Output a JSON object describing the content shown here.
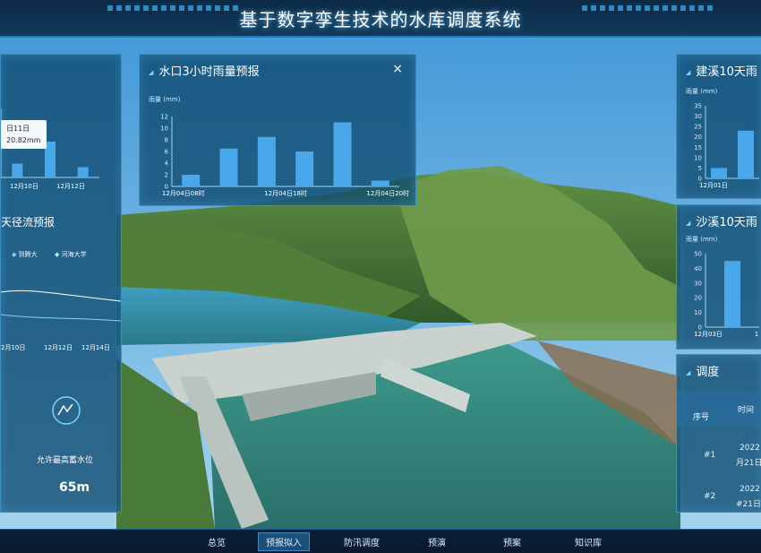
{
  "app": {
    "title": "基于数字孪生技术的水库调度系统"
  },
  "colors": {
    "accent": "#3aa0e0",
    "panel": "#0e4a70",
    "bar": "#4aa8ea"
  },
  "nav": {
    "items": [
      {
        "label": "总览"
      },
      {
        "label": "预报拟入"
      },
      {
        "label": "防汛调度"
      },
      {
        "label": "预演"
      },
      {
        "label": "预案"
      },
      {
        "label": "知识库"
      }
    ],
    "active_index": 1
  },
  "left_panel": {
    "tooltip_line1": "日11日",
    "tooltip_line2": "20.82mm",
    "top_xticks": [
      "12月10日",
      "12月12日"
    ],
    "runoff_title": "天径流预报",
    "legend": [
      "到腾大",
      "河海大学"
    ],
    "runoff_xticks": [
      "2月10日",
      "12月12日",
      "12月14日"
    ],
    "label_allow": "允许最高蓄水位",
    "value_65": "65m"
  },
  "center_panel": {
    "title": "水口3小时雨量预报",
    "close_label": "×",
    "unit_label": "雨量 (mm)",
    "yticks": [
      "12",
      "10",
      "8",
      "6",
      "4",
      "2",
      "0"
    ],
    "xticks": [
      "12月04日08时",
      "12月04日18时",
      "12月04日20时"
    ]
  },
  "right_panel_top": {
    "title": "建溪10天雨",
    "unit_label": "雨量 (mm)",
    "yticks": [
      "35",
      "30",
      "25",
      "20",
      "15",
      "10",
      "5",
      "0"
    ],
    "xticks": [
      "12月01日"
    ]
  },
  "right_panel_mid": {
    "title": "沙溪10天雨",
    "unit_label": "雨量 (mm)",
    "yticks": [
      "50",
      "40",
      "30",
      "20",
      "10",
      "0"
    ],
    "xticks": [
      "12月03日",
      "1"
    ]
  },
  "right_panel_bottom": {
    "title": "调度",
    "col_headers": [
      "序号",
      "时间"
    ],
    "rows": [
      {
        "index": "#1",
        "line1": "2022",
        "line2": "月21日"
      },
      {
        "index": "#2",
        "line1": "2022",
        "line2": "#21日"
      }
    ]
  },
  "chart_data": [
    {
      "type": "bar",
      "title": "水口3小时雨量预报",
      "ylabel": "雨量 (mm)",
      "ylim": [
        0,
        12
      ],
      "tick_labels": [
        "12月04日08时",
        "12月04日18时",
        "12月04日20时"
      ],
      "values": [
        2,
        6.5,
        8.5,
        6,
        11,
        1
      ]
    },
    {
      "type": "bar",
      "title": "建溪10天雨",
      "ylabel": "雨量 (mm)",
      "ylim": [
        0,
        35
      ],
      "tick_labels": [
        "12月01日"
      ],
      "values": [
        5,
        23
      ]
    },
    {
      "type": "bar",
      "title": "沙溪10天雨",
      "ylabel": "雨量 (mm)",
      "ylim": [
        0,
        50
      ],
      "tick_labels": [
        "12月03日"
      ],
      "values": [
        45
      ]
    },
    {
      "type": "bar",
      "title": "",
      "ylim": [
        0,
        40
      ],
      "tick_labels": [
        "12月10日",
        "12月12日"
      ],
      "values": [
        8,
        20.82,
        6
      ]
    }
  ]
}
